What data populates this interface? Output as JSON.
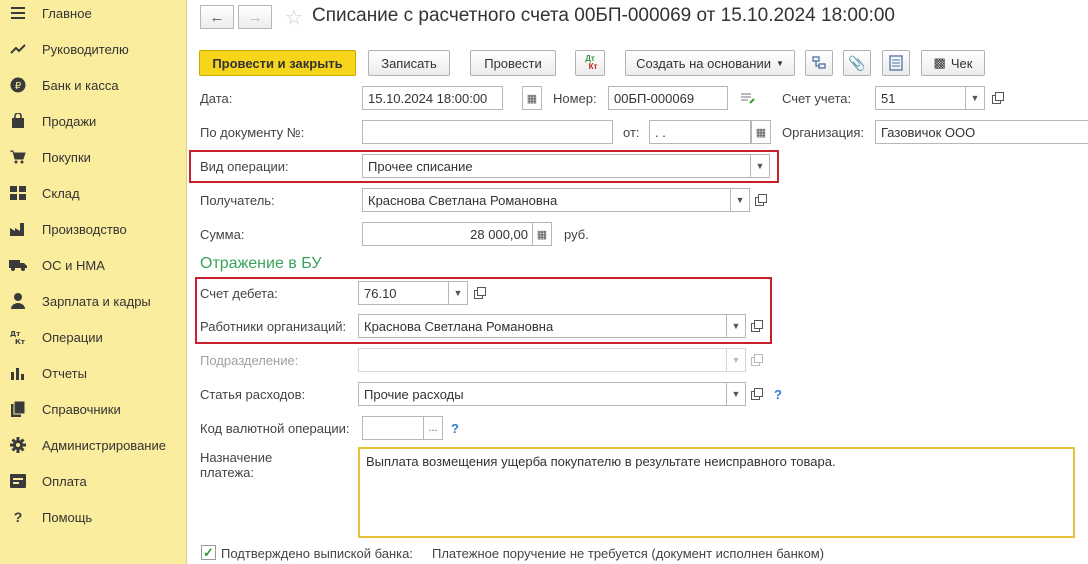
{
  "sidebar": {
    "items": [
      {
        "label": "Главное",
        "icon": "menu-icon"
      },
      {
        "label": "Руководителю",
        "icon": "trend-icon"
      },
      {
        "label": "Банк и касса",
        "icon": "ruble-icon"
      },
      {
        "label": "Продажи",
        "icon": "bag-icon"
      },
      {
        "label": "Покупки",
        "icon": "cart-icon"
      },
      {
        "label": "Склад",
        "icon": "warehouse-icon"
      },
      {
        "label": "Производство",
        "icon": "factory-icon"
      },
      {
        "label": "ОС и НМА",
        "icon": "truck-icon"
      },
      {
        "label": "Зарплата и кадры",
        "icon": "person-icon"
      },
      {
        "label": "Операции",
        "icon": "dt-kt-icon"
      },
      {
        "label": "Отчеты",
        "icon": "bar-chart-icon"
      },
      {
        "label": "Справочники",
        "icon": "books-icon"
      },
      {
        "label": "Администрирование",
        "icon": "gear-icon"
      },
      {
        "label": "Оплата",
        "icon": "payment-icon"
      },
      {
        "label": "Помощь",
        "icon": "help-icon"
      }
    ]
  },
  "header": {
    "title": "Списание с расчетного счета 00БП-000069 от 15.10.2024 18:00:00"
  },
  "toolbar": {
    "post_close": "Провести и закрыть",
    "save": "Записать",
    "post": "Провести",
    "dt_kt": "ДтКт",
    "create_based": "Создать на основании",
    "receipt": "Чек"
  },
  "form": {
    "date_label": "Дата:",
    "date_value": "15.10.2024 18:00:00",
    "number_label": "Номер:",
    "number_value": "00БП-000069",
    "account_label": "Счет учета:",
    "account_value": "51",
    "doc_no_label": "По документу №:",
    "doc_no_value": "",
    "from_label": "от:",
    "from_value": " .  .",
    "org_label": "Организация:",
    "org_value": "Газовичок ООО",
    "op_type_label": "Вид операции:",
    "op_type_value": "Прочее списание",
    "recipient_label": "Получатель:",
    "recipient_value": "Краснова Светлана Романовна",
    "sum_label": "Сумма:",
    "sum_value": "28 000,00",
    "currency": "руб.",
    "section_title": "Отражение в БУ",
    "debit_label": "Счет дебета:",
    "debit_value": "76.10",
    "employees_label": "Работники организаций:",
    "employees_value": "Краснова Светлана Романовна",
    "division_label": "Подразделение:",
    "division_value": "",
    "expense_label": "Статья расходов:",
    "expense_value": "Прочие расходы",
    "currency_op_label": "Код валютной операции:",
    "currency_op_value": "",
    "purpose_label": "Назначение платежа:",
    "purpose_value": "Выплата возмещения ущерба покупателю в результате неисправного товара.",
    "confirmed_label": "Подтверждено выпиской банка:",
    "confirmed_checked": true,
    "payment_order_text": "Платежное поручение не требуется (документ исполнен банком)"
  },
  "colors": {
    "sidebar_bg": "#fbed9e",
    "primary_button": "#f7d51b",
    "section_green": "#3aa35a",
    "highlight_red": "#c9202c",
    "textarea_border": "#e8c23a"
  }
}
